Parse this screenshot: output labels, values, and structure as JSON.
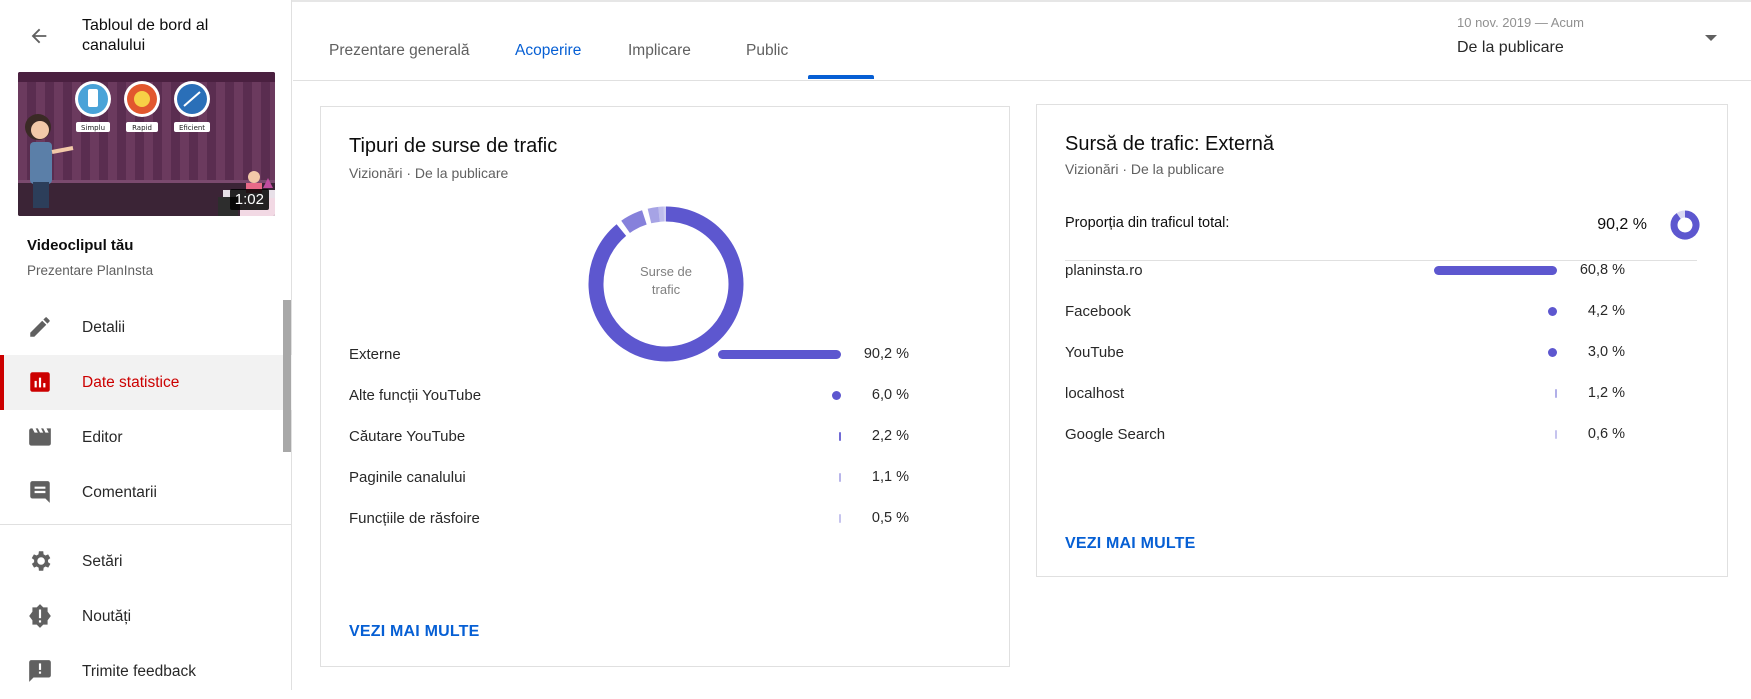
{
  "sidebar": {
    "dashboard_title": "Tabloul de bord al canalului",
    "video_duration": "1:02",
    "thumbnail_badges": [
      "Simplu",
      "Rapid",
      "Eficient"
    ],
    "video_title": "Videoclipul tău",
    "video_subtitle": "Prezentare PlanInsta",
    "items": [
      {
        "label": "Detalii",
        "icon": "pencil-icon"
      },
      {
        "label": "Date statistice",
        "icon": "analytics-icon",
        "active": true
      },
      {
        "label": "Editor",
        "icon": "clapperboard-icon"
      },
      {
        "label": "Comentarii",
        "icon": "comment-icon"
      },
      {
        "label": "Setări",
        "icon": "gear-icon"
      },
      {
        "label": "Noutăți",
        "icon": "alert-badge-icon"
      },
      {
        "label": "Trimite feedback",
        "icon": "feedback-icon"
      }
    ]
  },
  "header": {
    "tabs": [
      "Prezentare generală",
      "Acoperire",
      "Implicare",
      "Public"
    ],
    "active_tab": "Acoperire",
    "date_range_small": "10 nov. 2019 — Acum",
    "date_range_main": "De la publicare"
  },
  "card_traffic_types": {
    "title": "Tipuri de surse de trafic",
    "subtitle": "Vizionări · De la publicare",
    "donut_center": "Surse de trafic",
    "see_more": "VEZI MAI MULTE"
  },
  "card_external": {
    "title": "Sursă de trafic: Externă",
    "subtitle": "Vizionări · De la publicare",
    "share_label": "Proporția din traficul total:",
    "share_value": "90,2 %",
    "share_fraction": 0.902,
    "see_more": "VEZI MAI MULTE"
  },
  "colors": {
    "accent_blue": "#065fd4",
    "bar": "#5d57cf",
    "active_red": "#cc0000"
  },
  "chart_data": [
    {
      "type": "bar",
      "categories": [
        "Externe",
        "Alte funcții YouTube",
        "Căutare YouTube",
        "Paginile canalului",
        "Funcțiile de răsfoire"
      ],
      "values": [
        90.2,
        6.0,
        2.2,
        1.1,
        0.5
      ],
      "value_labels": [
        "90,2 %",
        "6,0 %",
        "2,2 %",
        "1,1 %",
        "0,5 %"
      ]
    },
    {
      "type": "bar",
      "categories": [
        "planinsta.ro",
        "Facebook",
        "YouTube",
        "localhost",
        "Google Search"
      ],
      "values": [
        60.8,
        4.2,
        3.0,
        1.2,
        0.6
      ],
      "value_labels": [
        "60,8 %",
        "4,2 %",
        "3,0 %",
        "1,2 %",
        "0,6 %"
      ]
    }
  ]
}
